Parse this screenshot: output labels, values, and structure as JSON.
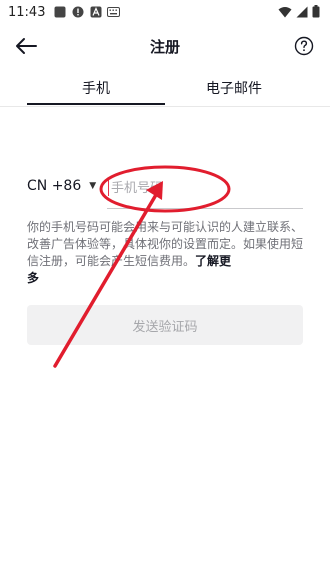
{
  "status_bar": {
    "time": "11:43"
  },
  "header": {
    "title": "注册"
  },
  "tabs": [
    {
      "label": "手机",
      "active": true
    },
    {
      "label": "电子邮件",
      "active": false
    }
  ],
  "phone_form": {
    "country_code": "CN +86",
    "input_value": "",
    "placeholder": "手机号码"
  },
  "disclaimer": {
    "text": "你的手机号码可能会用来与可能认识的人建立联系、改善广告体验等，具体视你的设置而定。如果使用短信注册，可能会产生短信费用。",
    "learn_more_line1": "了解更",
    "learn_more_line2": "多"
  },
  "send_code_button": {
    "label": "发送验证码",
    "enabled": false
  },
  "colors": {
    "annotation": "#e11d2e",
    "text_primary": "#161823",
    "text_secondary": "#6f7077",
    "button_disabled_bg": "#f1f1f2"
  }
}
